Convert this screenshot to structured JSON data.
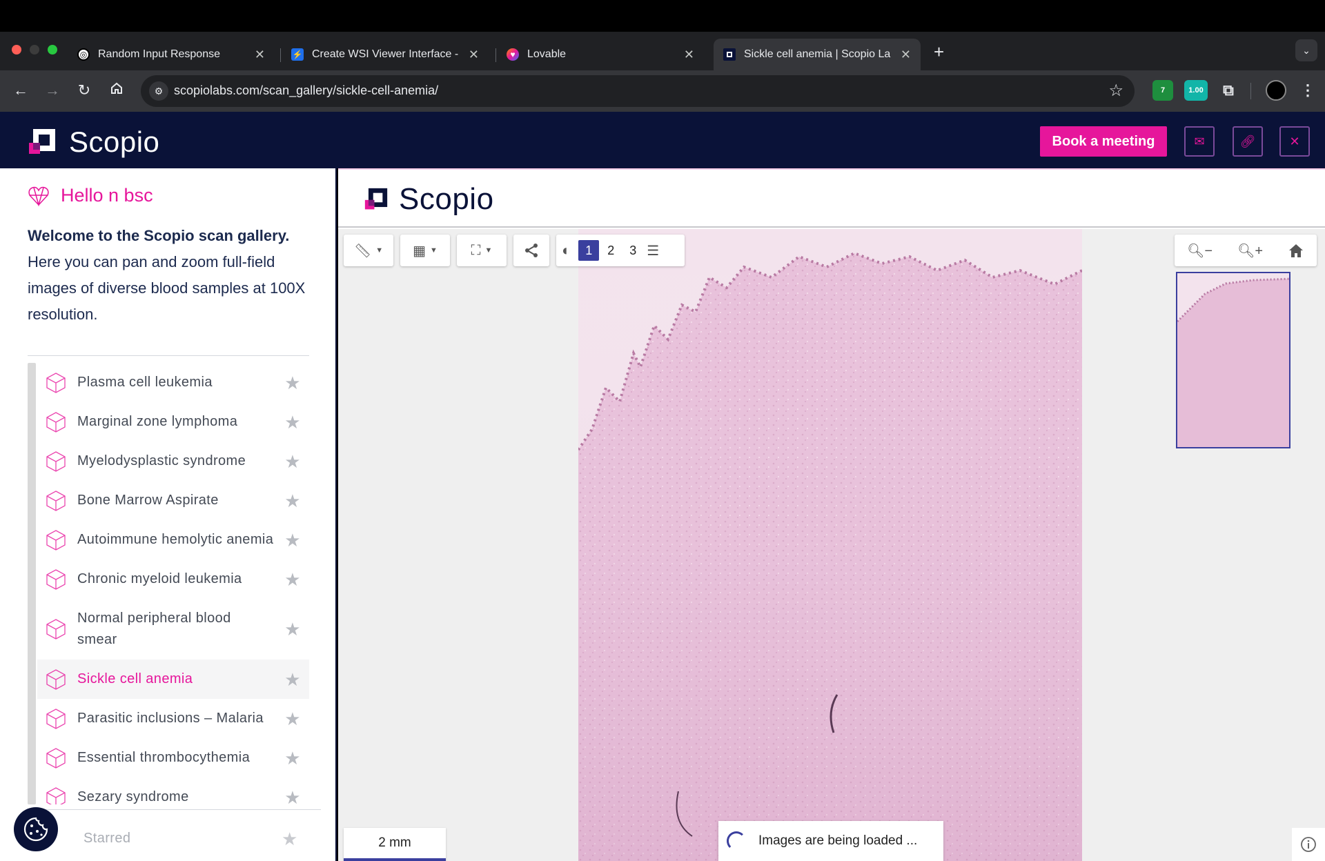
{
  "browser": {
    "tabs": [
      {
        "title": "Random Input Response",
        "favicon": "openai-icon",
        "active": false
      },
      {
        "title": "Create WSI Viewer Interface -",
        "favicon": "bolt-icon",
        "active": false
      },
      {
        "title": "Lovable",
        "favicon": "heart-icon",
        "active": false
      },
      {
        "title": "Sickle cell anemia | Scopio La",
        "favicon": "scopio-icon",
        "active": true
      }
    ],
    "url": "scopiolabs.com/scan_gallery/sickle-cell-anemia/",
    "extension_badges": {
      "shield_count": "7",
      "score": "1.00"
    }
  },
  "site_header": {
    "logo_text": "Scopio",
    "book_button": "Book a meeting",
    "icons": [
      "mail-icon",
      "link-icon",
      "close-icon"
    ]
  },
  "sidebar": {
    "greeting": "Hello n bsc",
    "welcome_bold": "Welcome to the Scopio scan gallery.",
    "welcome_rest": " Here you can pan and zoom full-field images of diverse blood samples at 100X resolution.",
    "items": [
      {
        "label": "Plasma cell leukemia",
        "active": false
      },
      {
        "label": "Marginal zone lymphoma",
        "active": false
      },
      {
        "label": "Myelodysplastic syndrome",
        "active": false
      },
      {
        "label": "Bone Marrow Aspirate",
        "active": false
      },
      {
        "label": "Autoimmune hemolytic anemia",
        "active": false
      },
      {
        "label": "Chronic myeloid leukemia",
        "active": false
      },
      {
        "label": "Normal peripheral blood smear",
        "active": false
      },
      {
        "label": "Sickle cell anemia",
        "active": true
      },
      {
        "label": "Parasitic inclusions – Malaria",
        "active": false
      },
      {
        "label": "Essential thrombocythemia",
        "active": false
      },
      {
        "label": "Sezary syndrome",
        "active": false
      }
    ],
    "starred_label": "Starred"
  },
  "viewer": {
    "logo_text": "Scopio",
    "pages": [
      "1",
      "2",
      "3"
    ],
    "selected_page": "1",
    "scale_label": "2 mm",
    "loading_text": "Images are being loaded ...",
    "tools": [
      "ruler-icon",
      "grid-icon",
      "zoom-region-icon",
      "share-icon",
      "brightness-icon",
      "adjust-icon"
    ],
    "zoom_controls": [
      "zoom-out-icon",
      "zoom-in-icon",
      "home-icon"
    ]
  },
  "colors": {
    "brand_pink": "#e6169b",
    "brand_navy": "#0a1238",
    "accent_blue": "#3a3f9e",
    "tissue": "#e9c4dc"
  }
}
